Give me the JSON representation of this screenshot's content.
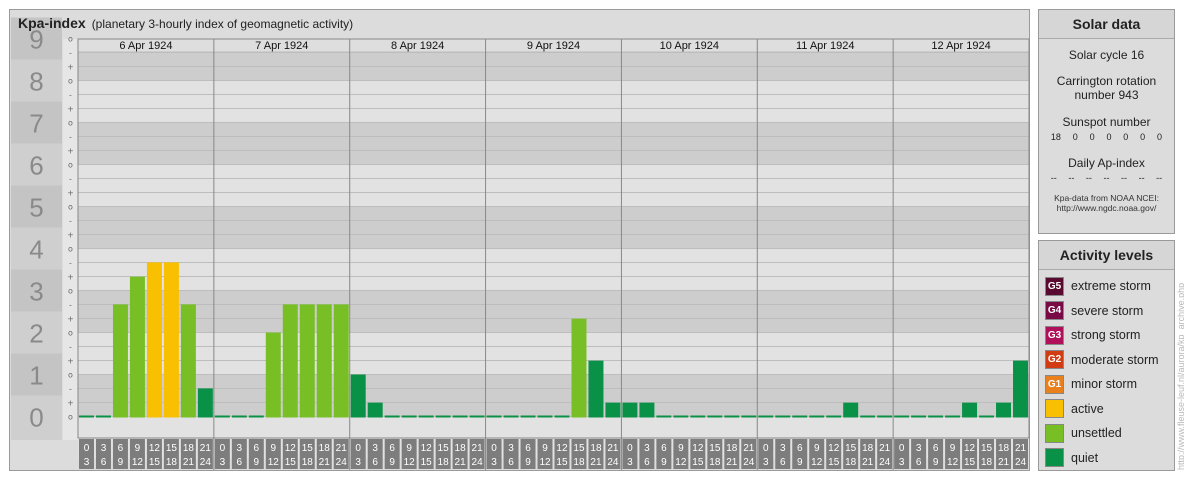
{
  "header": {
    "title": "Kpa-index",
    "subtitle": "(planetary 3-hourly index of geomagnetic activity)"
  },
  "chart_data": {
    "type": "bar",
    "title": "Kpa-index",
    "subtitle": "(planetary 3-hourly index of geomagnetic activity)",
    "ylim": [
      0,
      9
    ],
    "y_ticks": [
      "0",
      "1",
      "2",
      "3",
      "4",
      "5",
      "6",
      "7",
      "8",
      "9"
    ],
    "sub_ticks": [
      "+",
      "-",
      "o"
    ],
    "days": [
      "6 Apr 1924",
      "7 Apr 1924",
      "8 Apr 1924",
      "9 Apr 1924",
      "10 Apr 1924",
      "11 Apr 1924",
      "12 Apr 1924"
    ],
    "interval_labels": [
      [
        "0",
        "3"
      ],
      [
        "3",
        "6"
      ],
      [
        "6",
        "9"
      ],
      [
        "9",
        "12"
      ],
      [
        "12",
        "15"
      ],
      [
        "15",
        "18"
      ],
      [
        "18",
        "21"
      ],
      [
        "21",
        "24"
      ]
    ],
    "values": [
      [
        0,
        0,
        2.67,
        3.33,
        3.67,
        3.67,
        2.67,
        0.67
      ],
      [
        0,
        0,
        0,
        2,
        2.67,
        2.67,
        2.67,
        2.67
      ],
      [
        1,
        0.33,
        0,
        0,
        0,
        0,
        0,
        0
      ],
      [
        0,
        0,
        0,
        0,
        0,
        2.33,
        1.33,
        0.33
      ],
      [
        0.33,
        0.33,
        0,
        0,
        0,
        0,
        0,
        0
      ],
      [
        0,
        0,
        0,
        0,
        0,
        0.33,
        0,
        0
      ],
      [
        0,
        0,
        0,
        0,
        0.33,
        0,
        0.33,
        1.33
      ]
    ],
    "colors": {
      "quiet": "#0a9148",
      "unsettled": "#78bf26",
      "active": "#f8c000"
    }
  },
  "solar": {
    "heading": "Solar data",
    "cycle": "Solar cycle 16",
    "rotation_line1": "Carrington rotation",
    "rotation_line2": "number 943",
    "sunspot_label": "Sunspot number",
    "sunspots": [
      "18",
      "0",
      "0",
      "0",
      "0",
      "0",
      "0"
    ],
    "ap_label": "Daily Ap-index",
    "ap_values": [
      "--",
      "--",
      "--",
      "--",
      "--",
      "--",
      "--"
    ],
    "source_line1": "Kpa-data from NOAA NCEI:",
    "source_line2": "http://www.ngdc.noaa.gov/"
  },
  "activity": {
    "heading": "Activity levels",
    "levels": [
      {
        "badge": "G5",
        "label": "extreme storm",
        "color": "#5a0a2e"
      },
      {
        "badge": "G4",
        "label": "severe storm",
        "color": "#7a0a46"
      },
      {
        "badge": "G3",
        "label": "strong storm",
        "color": "#b0105a"
      },
      {
        "badge": "G2",
        "label": "moderate storm",
        "color": "#d23c12"
      },
      {
        "badge": "G1",
        "label": "minor storm",
        "color": "#e8801c"
      },
      {
        "badge": "",
        "label": "active",
        "color": "#f8c000"
      },
      {
        "badge": "",
        "label": "unsettled",
        "color": "#78bf26"
      },
      {
        "badge": "",
        "label": "quiet",
        "color": "#0a9148"
      }
    ]
  },
  "watermark": "http://www.fleuse-leuf.nl/aurora/kp_archive.php"
}
